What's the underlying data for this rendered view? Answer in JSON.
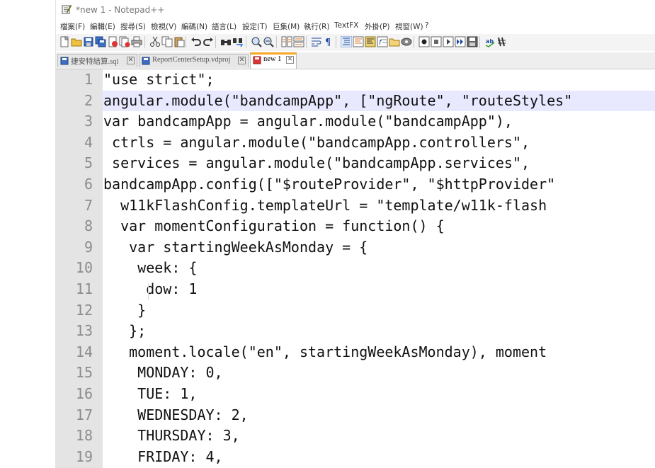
{
  "window": {
    "title": "*new 1 - Notepad++"
  },
  "menu": [
    "檔案(F)",
    "編輯(E)",
    "搜尋(S)",
    "檢視(V)",
    "編碼(N)",
    "語言(L)",
    "設定(T)",
    "巨集(M)",
    "執行(R)",
    "TextFX",
    "外掛(P)",
    "視窗(W)",
    "?"
  ],
  "toolbar_icons": [
    "new-file-icon",
    "open-file-icon",
    "save-icon",
    "save-all-icon",
    "close-icon",
    "close-all-icon",
    "print-icon",
    "cut-icon",
    "copy-icon",
    "paste-icon",
    "undo-icon",
    "redo-icon",
    "find-icon",
    "replace-icon",
    "zoom-in-icon",
    "zoom-out-icon",
    "sync-vertical-icon",
    "sync-horizontal-icon",
    "word-wrap-icon",
    "show-all-chars-icon",
    "indent-guide-icon",
    "user-language-icon",
    "document-map-icon",
    "function-list-icon",
    "folder-workspace-icon",
    "monitoring-icon",
    "record-macro-icon",
    "stop-macro-icon",
    "play-macro-icon",
    "run-macro-multiple-icon",
    "save-macro-icon",
    "spell-check-icon",
    "spell-options-icon"
  ],
  "tabs": [
    {
      "label": "捷安特結算.sql",
      "icon": "sql-file-icon",
      "active": false
    },
    {
      "label": "ReportCenterSetup.vdproj",
      "icon": "file-icon",
      "active": false
    },
    {
      "label": "new 1",
      "icon": "unsaved-file-icon",
      "active": true
    }
  ],
  "editor": {
    "current_line": 2,
    "lines": [
      {
        "n": "1",
        "text": "\"use strict\";"
      },
      {
        "n": "2",
        "text": "angular.module(\"bandcampApp\", [\"ngRoute\", \"routeStyles\""
      },
      {
        "n": "3",
        "text": "var bandcampApp = angular.module(\"bandcampApp\"),"
      },
      {
        "n": "4",
        "text": " ctrls = angular.module(\"bandcampApp.controllers\","
      },
      {
        "n": "5",
        "text": " services = angular.module(\"bandcampApp.services\","
      },
      {
        "n": "6",
        "text": "bandcampApp.config([\"$routeProvider\", \"$httpProvider\""
      },
      {
        "n": "7",
        "text": "  w11kFlashConfig.templateUrl = \"template/w11k-flash"
      },
      {
        "n": "8",
        "text": "  var momentConfiguration = function() {"
      },
      {
        "n": "9",
        "text": "   var startingWeekAsMonday = {"
      },
      {
        "n": "10",
        "text": "    week: {"
      },
      {
        "n": "11",
        "text": "     dow: 1"
      },
      {
        "n": "12",
        "text": "    }"
      },
      {
        "n": "13",
        "text": "   };"
      },
      {
        "n": "14",
        "text": "   moment.locale(\"en\", startingWeekAsMonday), moment"
      },
      {
        "n": "15",
        "text": "    MONDAY: 0,"
      },
      {
        "n": "16",
        "text": "    TUE: 1,"
      },
      {
        "n": "17",
        "text": "    WEDNESDAY: 2,"
      },
      {
        "n": "18",
        "text": "    THURSDAY: 3,"
      },
      {
        "n": "19",
        "text": "    FRIDAY: 4,"
      }
    ]
  },
  "colors": {
    "gutter_bg": "#e4e4e4",
    "current_line_bg": "#e8e8ff",
    "active_tab_accent": "#f5a623",
    "line_number": "#8c8c8c"
  }
}
